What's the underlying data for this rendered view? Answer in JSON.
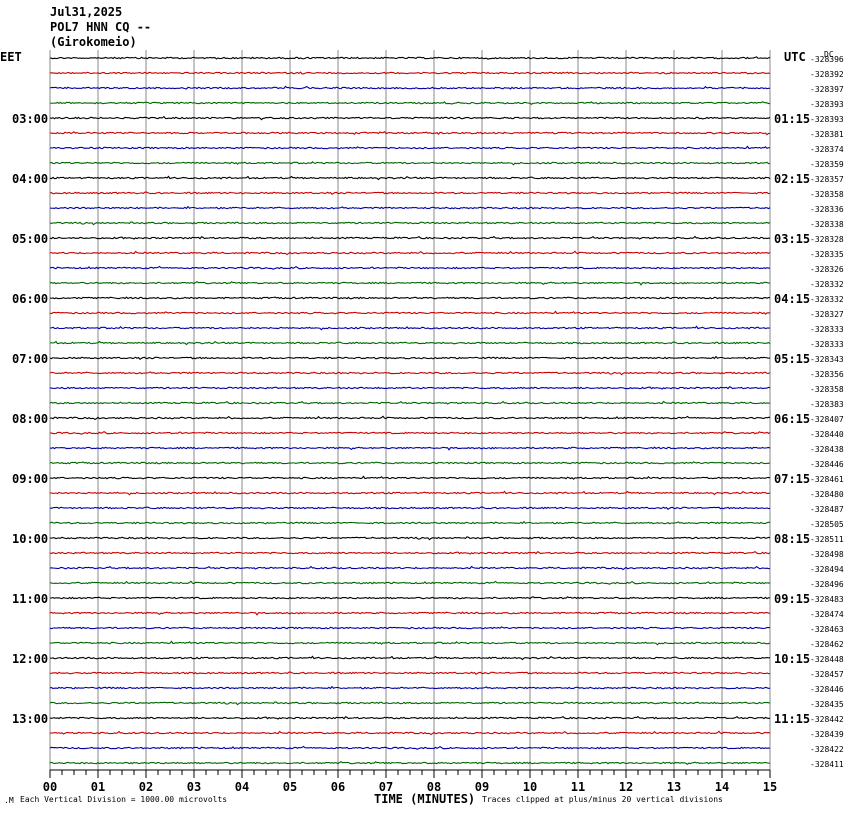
{
  "header": {
    "date": "Jul31,2025",
    "station": "POL7 HNN CQ --",
    "location": "(Girokomeio)"
  },
  "chart_data": {
    "type": "line",
    "title": "Jul31,2025 POL7 HNN CQ -- (Girokomeio)",
    "left_tz_label": "EET",
    "right_tz_label": "UTC",
    "dc_label": "DC",
    "xlabel": "TIME (MINUTES)",
    "x_ticks": [
      "00",
      "01",
      "02",
      "03",
      "04",
      "05",
      "06",
      "07",
      "08",
      "09",
      "10",
      "11",
      "12",
      "13",
      "14",
      "15"
    ],
    "xlim": [
      0,
      15
    ],
    "left_hour_labels": [
      "03:00",
      "04:00",
      "05:00",
      "06:00",
      "07:00",
      "08:00",
      "09:00",
      "10:00",
      "11:00",
      "12:00",
      "13:00"
    ],
    "right_hour_labels": [
      "01:15",
      "02:15",
      "03:15",
      "04:15",
      "05:15",
      "06:15",
      "07:15",
      "08:15",
      "09:15",
      "10:15",
      "11:15"
    ],
    "trace_colors": [
      "#000000",
      "#cc0000",
      "#0000aa",
      "#006600"
    ],
    "num_traces": 48,
    "dc_offsets": [
      "-328396",
      "-328392",
      "-328397",
      "-328393",
      "-328393",
      "-328381",
      "-328374",
      "-328359",
      "-328357",
      "-328358",
      "-328336",
      "-328338",
      "-328328",
      "-328335",
      "-328326",
      "-328332",
      "-328332",
      "-328327",
      "-328333",
      "-328333",
      "-328343",
      "-328356",
      "-328358",
      "-328383",
      "-328407",
      "-328440",
      "-328438",
      "-328446",
      "-328461",
      "-328480",
      "-328487",
      "-328505",
      "-328511",
      "-328498",
      "-328494",
      "-328496",
      "-328483",
      "-328474",
      "-328463",
      "-328462",
      "-328448",
      "-328457",
      "-328446",
      "-328435",
      "-328442",
      "-328439",
      "-328422",
      "-328411"
    ],
    "footer_left": "Each Vertical Division = 1000.00 microvolts",
    "footer_right": "Traces clipped at plus/minus 20 vertical divisions"
  }
}
